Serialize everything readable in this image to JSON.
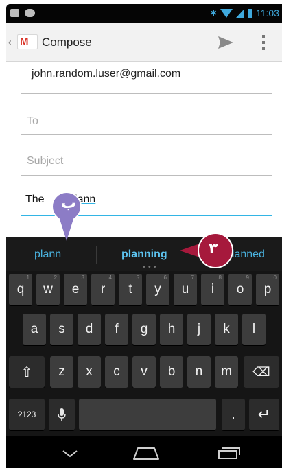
{
  "status_bar": {
    "time": "11:03",
    "left_icons": [
      "mail-notification-icon",
      "voicemail-icon"
    ],
    "right_icons": [
      "bluetooth-icon",
      "wifi-icon",
      "signal-icon",
      "battery-icon"
    ],
    "accent": "#3fa9dd"
  },
  "action_bar": {
    "back_glyph": "‹",
    "logo_letter": "M",
    "title": "Compose",
    "icons": [
      "send-icon",
      "overflow-menu-icon"
    ]
  },
  "compose": {
    "from": "john.random.luser@gmail.com",
    "to_placeholder": "To",
    "subject_placeholder": "Subject",
    "body_prefix": "The",
    "body_word": "plann",
    "accent": "#33b5e5"
  },
  "suggestions": {
    "items": [
      "plann",
      "planning",
      "planned"
    ],
    "selected": "planning",
    "more_indicator": "•••"
  },
  "keyboard": {
    "row1": [
      {
        "label": "q",
        "hint": "1"
      },
      {
        "label": "w",
        "hint": "2"
      },
      {
        "label": "e",
        "hint": "3"
      },
      {
        "label": "r",
        "hint": "4"
      },
      {
        "label": "t",
        "hint": "5"
      },
      {
        "label": "y",
        "hint": "6"
      },
      {
        "label": "u",
        "hint": "7"
      },
      {
        "label": "i",
        "hint": "8"
      },
      {
        "label": "o",
        "hint": "9"
      },
      {
        "label": "p",
        "hint": "0"
      }
    ],
    "row2": [
      "a",
      "s",
      "d",
      "f",
      "g",
      "h",
      "j",
      "k",
      "l"
    ],
    "row3": [
      "z",
      "x",
      "c",
      "v",
      "b",
      "n",
      "m"
    ],
    "shift_glyph": "⇧",
    "backspace_glyph": "⌫",
    "symbols_label": "?123",
    "mic_glyph": "🎤",
    "period_label": ".",
    "enter_glyph": "↵"
  },
  "annotations": {
    "marker_b": "ب",
    "marker_3": "۳",
    "colors": {
      "marker_b": "#8c7cc6",
      "marker_3": "#a6193c"
    }
  },
  "nav_bar": {
    "icons": [
      "back-icon",
      "home-icon",
      "recent-apps-icon"
    ]
  }
}
